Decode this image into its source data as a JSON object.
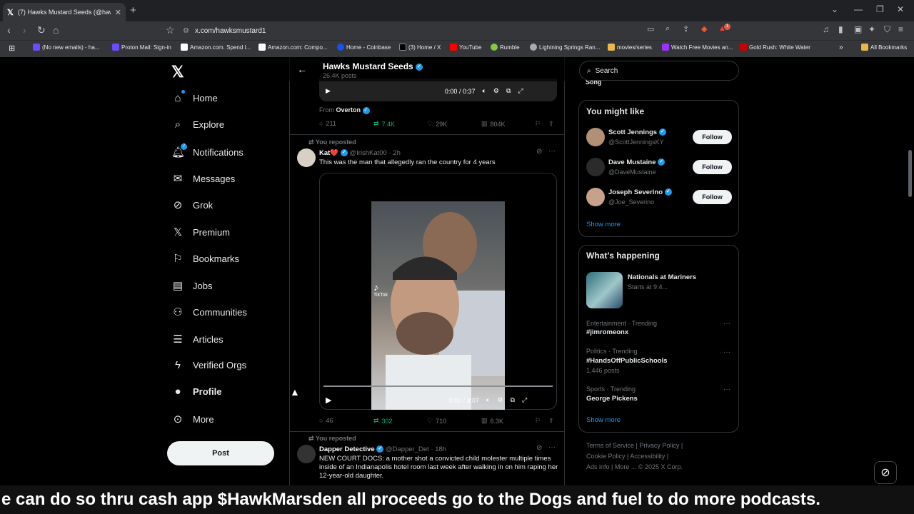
{
  "browser": {
    "tab_title": "(7) Hawks Mustard Seeds (@hawksm",
    "url": "x.com/hawksmustard1",
    "bookmarks": [
      "(No new emails) - ha...",
      "Proton Mail: Sign-in",
      "Amazon.com. Spend l...",
      "Amazon.com: Compo...",
      "Home - Coinbase",
      "(3) Home / X",
      "YouTube",
      "Rumble",
      "Lightning Springs Ran...",
      "movies/series",
      "Watch Free Movies an...",
      "Gold Rush: White Water"
    ],
    "all_bookmarks": "All Bookmarks",
    "notif_count": "1"
  },
  "nav": {
    "items": [
      "Home",
      "Explore",
      "Notifications",
      "Messages",
      "Grok",
      "Premium",
      "Bookmarks",
      "Jobs",
      "Communities",
      "Articles",
      "Verified Orgs",
      "Profile",
      "More"
    ],
    "notifications_badge": "7",
    "post_label": "Post"
  },
  "header": {
    "title": "Hawks Mustard Seeds",
    "subtitle": "26.4K posts"
  },
  "post0": {
    "video_time": "0:00 / 0:37",
    "from_label": "From",
    "from_name": "Overton",
    "replies": "211",
    "reposts": "7.4K",
    "likes": "29K",
    "views": "804K"
  },
  "post1": {
    "repost_label": "You reposted",
    "name": "Kat❤️",
    "handle": "@IrishKat00",
    "time": "· 2h",
    "text": "This was the man that allegedly ran the country for 4 years",
    "watermark": "TikTok",
    "video_time": "0:00 / 3:07",
    "replies": "46",
    "reposts": "302",
    "likes": "710",
    "views": "6.3K"
  },
  "post2": {
    "repost_label": "You reposted",
    "name": "Dapper Detective",
    "handle": "@Dapper_Det",
    "time": "· 18h",
    "text": "NEW COURT DOCS: a mother shot a convicted child molester multiple times inside of an Indianapolis hotel room last week after walking in on him raping her 12-year-old daughter."
  },
  "search": {
    "placeholder": "Search"
  },
  "you_might_like": {
    "title": "You might like",
    "users": [
      {
        "name": "Scott Jennings",
        "handle": "@ScottJenningsKY"
      },
      {
        "name": "Dave Mustaine",
        "handle": "@DaveMustaine"
      },
      {
        "name": "Joseph Severino",
        "handle": "@Joe_Severino"
      }
    ],
    "follow_label": "Follow",
    "show_more": "Show more"
  },
  "happening": {
    "title": "What’s happening",
    "event": {
      "title": "Nationals at Mariners",
      "sub": "Starts at 9:4..."
    },
    "trends": [
      {
        "cat": "Entertainment · Trending",
        "topic": "#jimromeonx",
        "posts": ""
      },
      {
        "cat": "Politics · Trending",
        "topic": "#HandsOffPublicSchools",
        "posts": "1,446 posts"
      },
      {
        "cat": "Sports · Trending",
        "topic": "George Pickens",
        "posts": ""
      }
    ],
    "show_more": "Show more"
  },
  "footer": {
    "line1": "Terms of Service  |  Privacy Policy  |",
    "line2": "Cookie Policy  |  Accessibility  |",
    "line3": "Ads info  |  More ...  © 2025 X Corp."
  },
  "caption": "e can do so thru cash app $HawkMarsden all proceeds go to the Dogs and fuel to do more podcasts.",
  "colors": {
    "accent": "#1d9bf0",
    "repost": "#00ba7c",
    "bg": "#000000"
  }
}
